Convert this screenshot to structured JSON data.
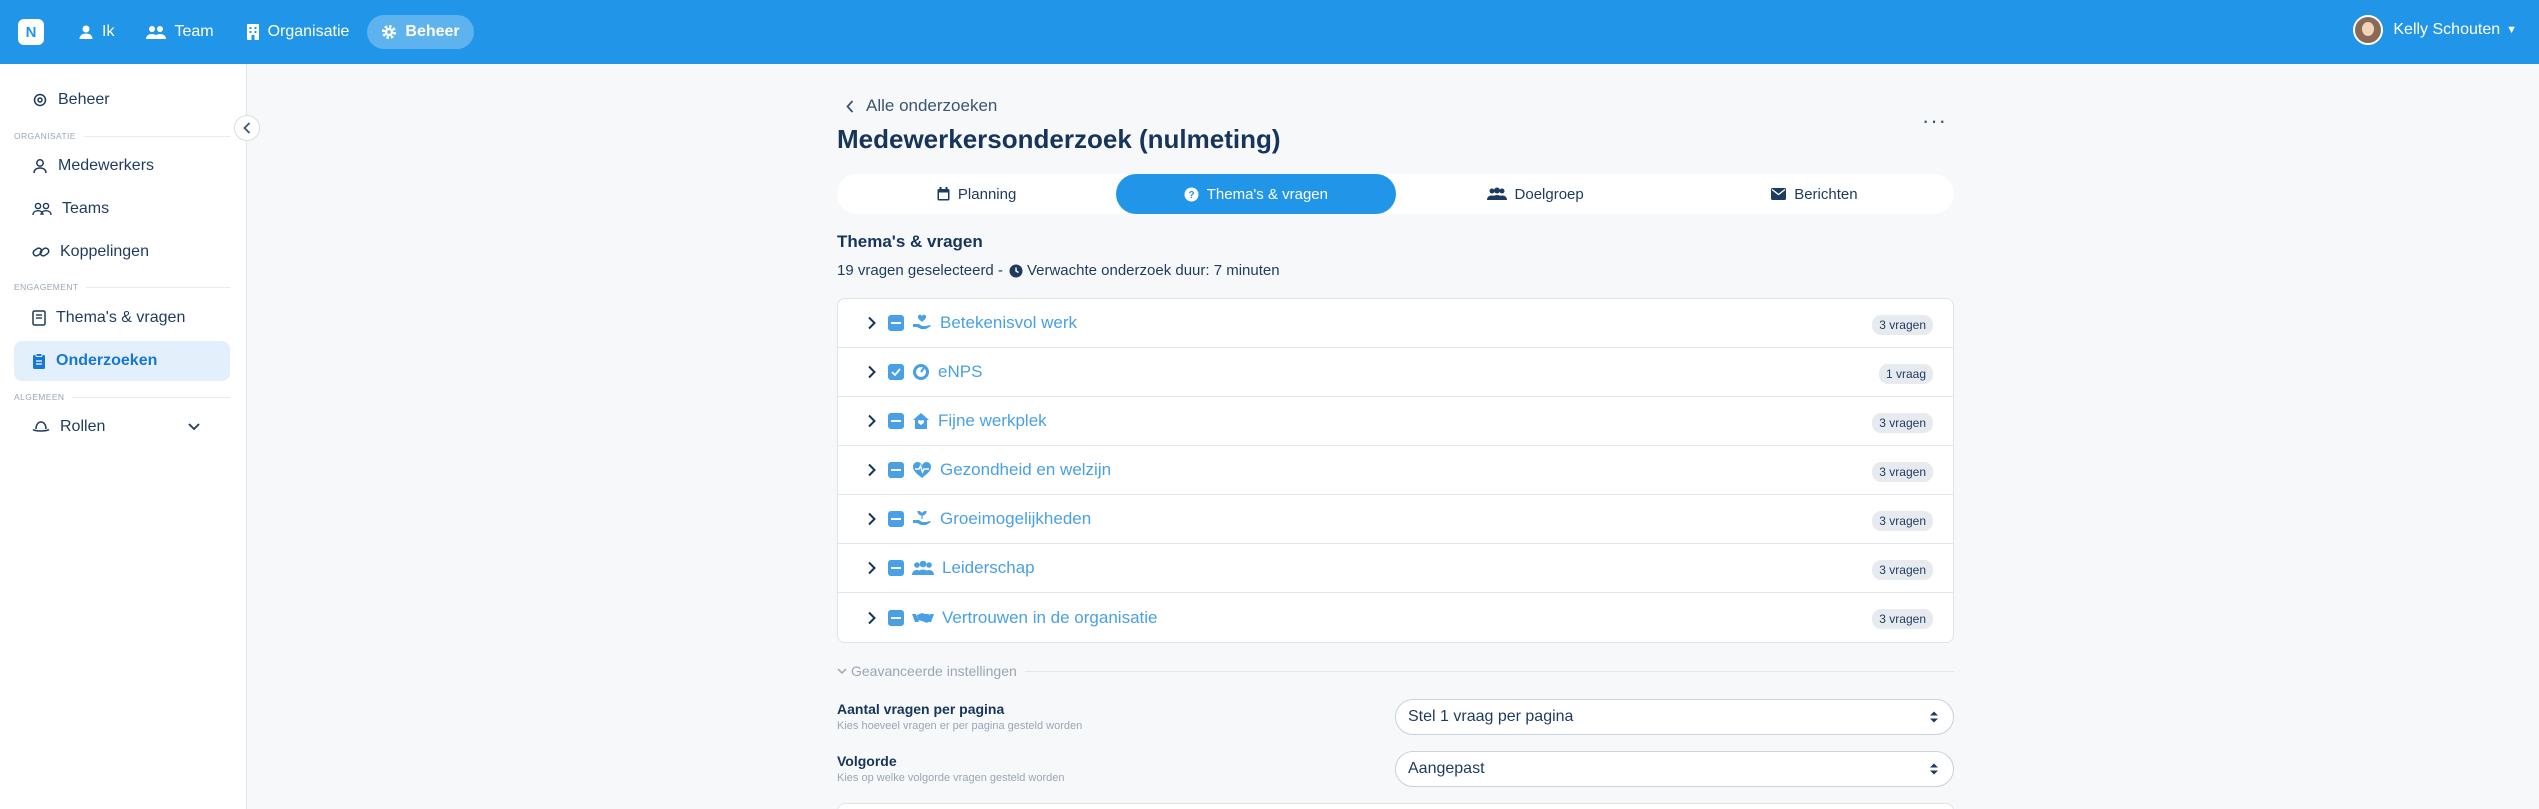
{
  "topbar": {
    "logo": "N",
    "nav": [
      {
        "label": "Ik"
      },
      {
        "label": "Team"
      },
      {
        "label": "Organisatie"
      },
      {
        "label": "Beheer"
      }
    ],
    "user_name": "Kelly Schouten"
  },
  "sidebar": {
    "top_item": "Beheer",
    "sections": {
      "organisatie": "ORGANISATIE",
      "engagement": "ENGAGEMENT",
      "algemeen": "ALGEMEEN"
    },
    "items": {
      "medewerkers": "Medewerkers",
      "teams": "Teams",
      "koppelingen": "Koppelingen",
      "themas": "Thema's & vragen",
      "onderzoeken": "Onderzoeken",
      "rollen": "Rollen"
    }
  },
  "main": {
    "back_label": "Alle onderzoeken",
    "title": "Medewerkersonderzoek (nulmeting)",
    "more_label": "···",
    "tabs": [
      {
        "label": "Planning"
      },
      {
        "label": "Thema's & vragen"
      },
      {
        "label": "Doelgroep"
      },
      {
        "label": "Berichten"
      }
    ],
    "section_title": "Thema's & vragen",
    "summary_left": "19 vragen geselecteerd -",
    "summary_right": "Verwachte onderzoek duur: 7 minuten",
    "themes": [
      {
        "label": "Betekenisvol werk",
        "badge": "3 vragen",
        "icon": "hand-heart-icon",
        "checked": "partial"
      },
      {
        "label": "eNPS",
        "badge": "1 vraag",
        "icon": "gauge-icon",
        "checked": "full"
      },
      {
        "label": "Fijne werkplek",
        "badge": "3 vragen",
        "icon": "home-heart-icon",
        "checked": "partial"
      },
      {
        "label": "Gezondheid en welzijn",
        "badge": "3 vragen",
        "icon": "heart-pulse-icon",
        "checked": "partial"
      },
      {
        "label": "Groeimogelijkheden",
        "badge": "3 vragen",
        "icon": "hand-seedling-icon",
        "checked": "partial"
      },
      {
        "label": "Leiderschap",
        "badge": "3 vragen",
        "icon": "users-icon",
        "checked": "partial"
      },
      {
        "label": "Vertrouwen in de organisatie",
        "badge": "3 vragen",
        "icon": "handshake-icon",
        "checked": "partial"
      }
    ],
    "advanced_label": "Geavanceerde instellingen",
    "settings": {
      "per_page_label": "Aantal vragen per pagina",
      "per_page_help": "Kies hoeveel vragen er per pagina gesteld worden",
      "per_page_value": "Stel 1 vraag per pagina",
      "order_label": "Volgorde",
      "order_help": "Kies op welke volgorde vragen gesteld worden",
      "order_value": "Aangepast"
    }
  },
  "colors": {
    "brand": "#2196e8",
    "accent_text": "#4aa0e6",
    "dark_text": "#17355a"
  }
}
